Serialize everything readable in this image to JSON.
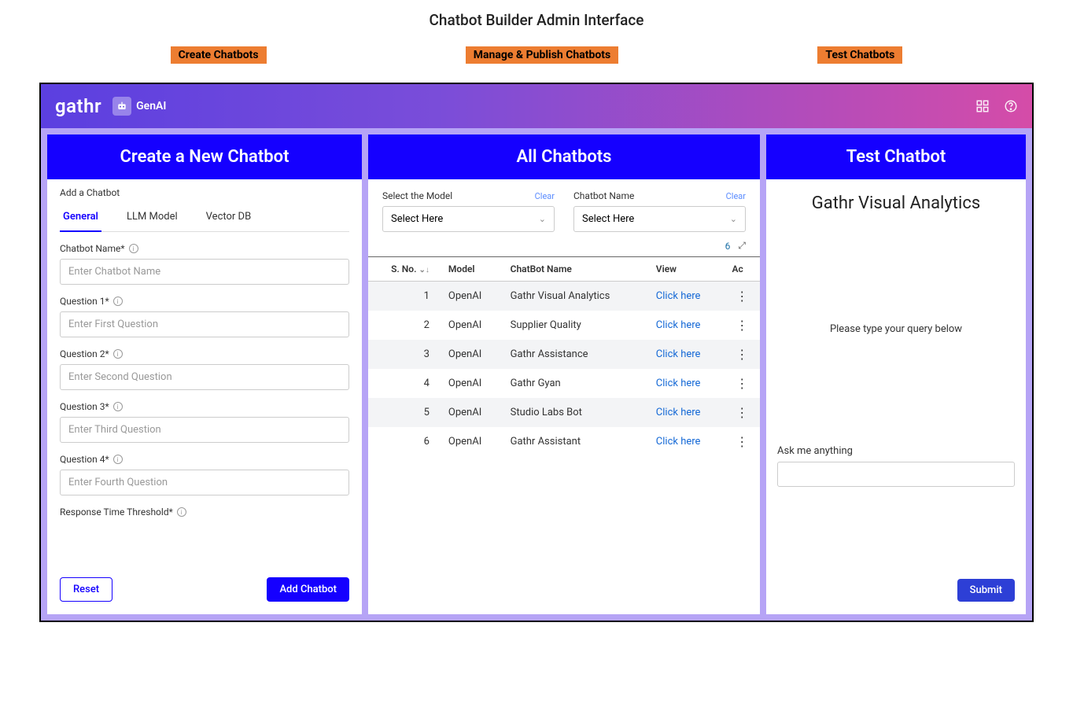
{
  "page_title": "Chatbot Builder Admin Interface",
  "callouts": [
    "Create Chatbots",
    "Manage & Publish Chatbots",
    "Test Chatbots"
  ],
  "header": {
    "brand": "gathr",
    "product": "GenAI"
  },
  "create": {
    "panel_title": "Create a New Chatbot",
    "subtitle": "Add a Chatbot",
    "tabs": [
      "General",
      "LLM Model",
      "Vector DB"
    ],
    "fields": {
      "name_label": "Chatbot Name*",
      "name_placeholder": "Enter Chatbot Name",
      "q1_label": "Question 1*",
      "q1_placeholder": "Enter First Question",
      "q2_label": "Question 2*",
      "q2_placeholder": "Enter Second Question",
      "q3_label": "Question 3*",
      "q3_placeholder": "Enter Third Question",
      "q4_label": "Question 4*",
      "q4_placeholder": "Enter Fourth Question",
      "rtt_label": "Response Time Threshold*"
    },
    "reset": "Reset",
    "add": "Add Chatbot"
  },
  "all": {
    "panel_title": "All Chatbots",
    "model_filter_label": "Select the Model",
    "name_filter_label": "Chatbot Name",
    "select_placeholder": "Select Here",
    "clear": "Clear",
    "count": "6",
    "cols": {
      "sno": "S. No.",
      "model": "Model",
      "name": "ChatBot Name",
      "view": "View",
      "action": "Ac"
    },
    "view_text": "Click here",
    "rows": [
      {
        "sno": "1",
        "model": "OpenAI",
        "name": "Gathr Visual Analytics"
      },
      {
        "sno": "2",
        "model": "OpenAI",
        "name": "Supplier Quality"
      },
      {
        "sno": "3",
        "model": "OpenAI",
        "name": "Gathr Assistance"
      },
      {
        "sno": "4",
        "model": "OpenAI",
        "name": "Gathr Gyan"
      },
      {
        "sno": "5",
        "model": "OpenAI",
        "name": "Studio Labs Bot"
      },
      {
        "sno": "6",
        "model": "OpenAI",
        "name": "Gathr Assistant"
      }
    ]
  },
  "test": {
    "panel_title": "Test Chatbot",
    "title": "Gathr Visual Analytics",
    "prompt": "Please type your query below",
    "ask_label": "Ask me anything",
    "submit": "Submit"
  }
}
